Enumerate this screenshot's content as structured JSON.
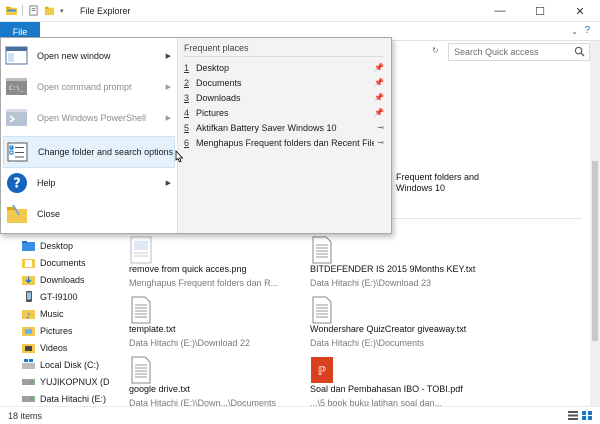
{
  "window": {
    "title": "File Explorer"
  },
  "ribbon": {
    "file_tab": "File"
  },
  "search": {
    "placeholder": "Search Quick access"
  },
  "file_menu": {
    "items": [
      {
        "label": "Open new window",
        "disabled": false,
        "has_arrow": true
      },
      {
        "label": "Open command prompt",
        "disabled": true,
        "has_arrow": true
      },
      {
        "label": "Open Windows PowerShell",
        "disabled": true,
        "has_arrow": true
      },
      {
        "label": "Change folder and search options",
        "disabled": false,
        "has_arrow": false
      },
      {
        "label": "Help",
        "disabled": false,
        "has_arrow": true
      },
      {
        "label": "Close",
        "disabled": false,
        "has_arrow": false
      }
    ],
    "frequent_header": "Frequent places",
    "frequent_places": [
      {
        "num": "1",
        "name": "Desktop",
        "pinned": true
      },
      {
        "num": "2",
        "name": "Documents",
        "pinned": true
      },
      {
        "num": "3",
        "name": "Downloads",
        "pinned": true
      },
      {
        "num": "4",
        "name": "Pictures",
        "pinned": true
      },
      {
        "num": "5",
        "name": "Aktifkan Battery Saver Windows 10",
        "pinned": false
      },
      {
        "num": "6",
        "name": "Menghapus Frequent folders dan Recent Files...",
        "pinned": false
      }
    ]
  },
  "background_partial": {
    "line1": "Frequent folders and",
    "line2": "Windows 10"
  },
  "nav": {
    "items": [
      {
        "label": "Desktop",
        "icon": "desktop-folder-icon"
      },
      {
        "label": "Documents",
        "icon": "documents-folder-icon"
      },
      {
        "label": "Downloads",
        "icon": "downloads-folder-icon"
      },
      {
        "label": "GT-I9100",
        "icon": "phone-icon"
      },
      {
        "label": "Music",
        "icon": "music-folder-icon"
      },
      {
        "label": "Pictures",
        "icon": "pictures-folder-icon"
      },
      {
        "label": "Videos",
        "icon": "videos-folder-icon"
      },
      {
        "label": "Local Disk (C:)",
        "icon": "windows-drive-icon"
      },
      {
        "label": "YUJIKOPNUX (D",
        "icon": "drive-icon"
      },
      {
        "label": "Data Hitachi (E:)",
        "icon": "drive-icon"
      }
    ]
  },
  "files": [
    {
      "name": "remove from quick acces.png",
      "path": "Menghapus Frequent folders dan R...",
      "type": "image"
    },
    {
      "name": "BITDEFENDER IS 2015 9Months KEY.txt",
      "path": "Data Hitachi (E:)\\Download 23",
      "type": "text"
    },
    {
      "name": "template.txt",
      "path": "Data Hitachi (E:)\\Download 22",
      "type": "text"
    },
    {
      "name": "Wondershare QuizCreator giveaway.txt",
      "path": "Data Hitachi (E:)\\Documents",
      "type": "text"
    },
    {
      "name": "google drive.txt",
      "path": "Data Hitachi (E:)\\Down...\\Documents",
      "type": "text"
    },
    {
      "name": "Soal dan Pembahasan IBO - TOBI.pdf",
      "path": "...\\5 book buku latihan soal dan...",
      "type": "pdf"
    }
  ],
  "status": {
    "item_count": "18 items"
  },
  "colors": {
    "accent": "#1979ca",
    "hover": "#e5f1fb",
    "folder": "#f2c94c"
  }
}
